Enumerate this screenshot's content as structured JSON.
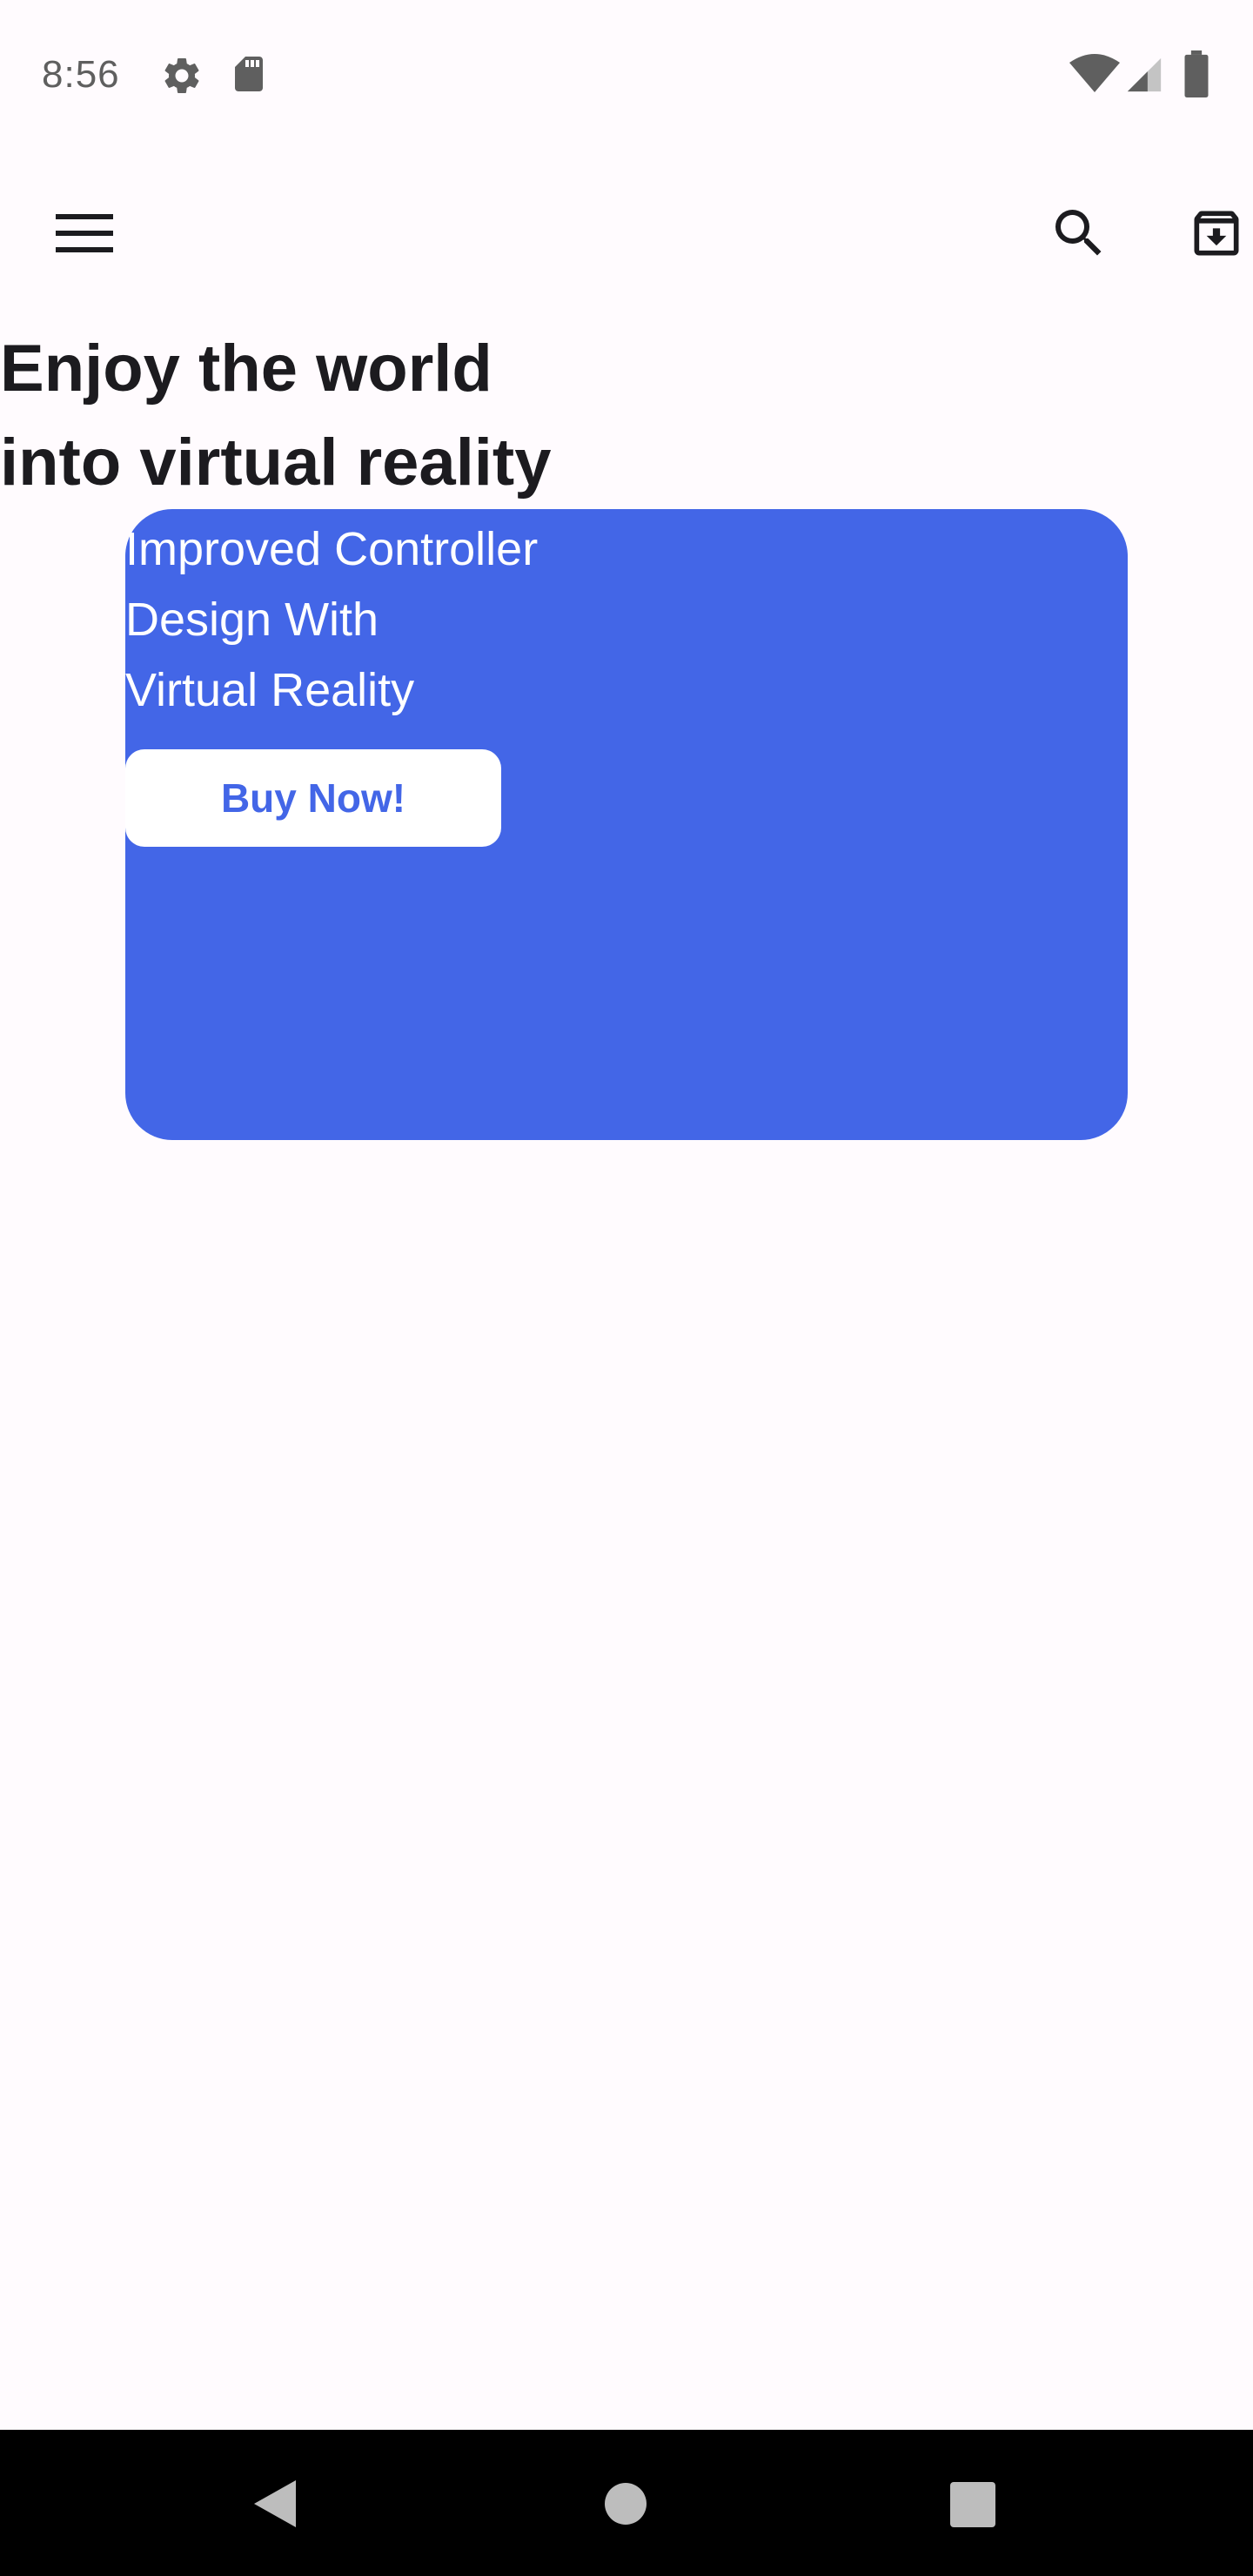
{
  "status_bar": {
    "time": "8:56",
    "icons": [
      "settings-icon",
      "sd-card-icon",
      "wifi-icon",
      "cell-signal-icon",
      "battery-icon"
    ]
  },
  "top_bar": {
    "icons": [
      "menu-icon",
      "search-icon",
      "archive-download-icon"
    ]
  },
  "hero": {
    "title_line_1": "Enjoy the world",
    "title_line_2": "into virtual reality"
  },
  "promo": {
    "line_1": "Improved Controller",
    "line_2": "Design With",
    "line_3": "Virtual Reality",
    "button_label": "Buy Now!",
    "card_color": "#4366e7"
  },
  "nav_bar": {
    "icons": [
      "back-icon",
      "home-icon",
      "recents-icon"
    ]
  },
  "colors": {
    "background": "#fffbfe",
    "accent": "#4366e7",
    "text": "#1c1b1f"
  }
}
